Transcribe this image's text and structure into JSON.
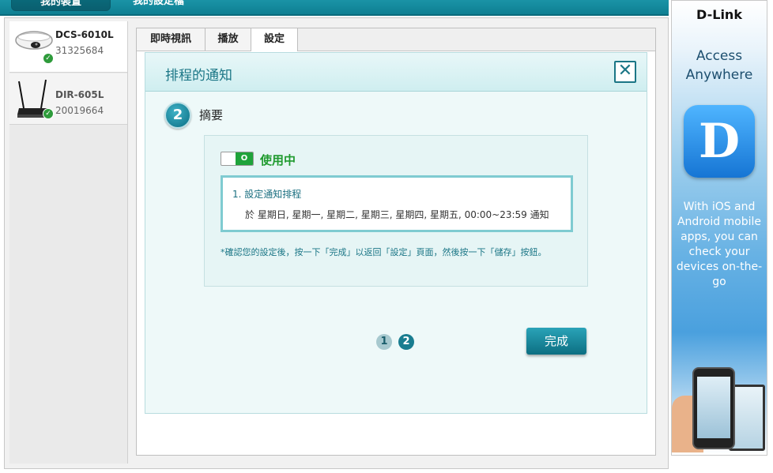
{
  "top_nav": {
    "tabs": [
      {
        "label": "我的裝置"
      },
      {
        "label": "我的設定檔"
      }
    ]
  },
  "devices": [
    {
      "name": "DCS-6010L",
      "serial": "31325684"
    },
    {
      "name": "DIR-605L",
      "serial": "20019664"
    }
  ],
  "subtabs": [
    {
      "label": "即時視訊"
    },
    {
      "label": "播放"
    },
    {
      "label": "設定"
    }
  ],
  "dialog": {
    "title": "排程的通知",
    "step_number": "2",
    "step_label": "摘要",
    "status": "使用中",
    "toggle_state": "O",
    "schedule_title": "1. 設定通知排程",
    "schedule_detail": "於 星期日, 星期一, 星期二, 星期三, 星期四, 星期五, 00:00~23:59 通知",
    "note": "*確認您的設定後，按一下「完成」以返回「設定」頁面，然後按一下「儲存」按鈕。",
    "pager": [
      "1",
      "2"
    ],
    "done_label": "完成",
    "close_symbol": "✕"
  },
  "ad": {
    "logo": "D-Link",
    "headline": "Access Anywhere",
    "app_letter": "D",
    "body": "With iOS and Android mobile apps, you can check your devices on-the-go"
  },
  "colors": {
    "brand_teal": "#1b7686",
    "active_green": "#1f9a2e"
  }
}
